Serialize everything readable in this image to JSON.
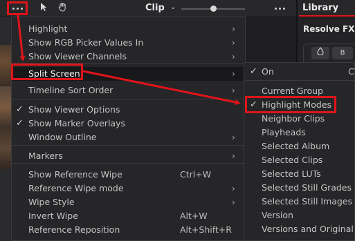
{
  "toolbar": {
    "more_icon": "ellipsis-icon",
    "pointer_icon": "pointer-icon",
    "hand_icon": "hand-icon",
    "mode_label": "Clip",
    "mode_chevron_icon": "chevron-down-icon",
    "zoom_level": 0.5,
    "right_more_icon": "ellipsis-icon"
  },
  "library": {
    "tab_label": "Library",
    "section_title": "Resolve FX B",
    "button_a_label": "🔥",
    "button_b_label": "B"
  },
  "menu": {
    "items": [
      {
        "label": "Highlight",
        "checked": false,
        "shortcut": "",
        "submenu": true
      },
      {
        "label": "Show RGB Picker Values In",
        "checked": false,
        "shortcut": "",
        "submenu": true
      },
      {
        "label": "Show Viewer Channels",
        "checked": false,
        "shortcut": "",
        "submenu": true
      },
      {
        "label": "Split Screen",
        "checked": false,
        "shortcut": "",
        "submenu": true
      },
      {
        "label": "Timeline Sort Order",
        "checked": false,
        "shortcut": "",
        "submenu": true
      },
      {
        "label": "Show Viewer Options",
        "checked": true,
        "shortcut": "",
        "submenu": false
      },
      {
        "label": "Show Marker Overlays",
        "checked": true,
        "shortcut": "",
        "submenu": false
      },
      {
        "label": "Window Outline",
        "checked": false,
        "shortcut": "",
        "submenu": true
      },
      {
        "label": "Markers",
        "checked": false,
        "shortcut": "",
        "submenu": true
      },
      {
        "label": "Show Reference Wipe",
        "checked": false,
        "shortcut": "Ctrl+W",
        "submenu": false
      },
      {
        "label": "Reference Wipe mode",
        "checked": false,
        "shortcut": "",
        "submenu": true
      },
      {
        "label": "Wipe Style",
        "checked": false,
        "shortcut": "",
        "submenu": true
      },
      {
        "label": "Invert Wipe",
        "checked": false,
        "shortcut": "Alt+W",
        "submenu": false
      },
      {
        "label": "Reference Reposition",
        "checked": false,
        "shortcut": "Alt+Shift+R",
        "submenu": false
      }
    ]
  },
  "submenu": {
    "items": [
      {
        "label": "On",
        "checked": true,
        "shortcut": "CT"
      },
      {
        "label": "Current Group",
        "checked": false,
        "shortcut": ""
      },
      {
        "label": "Highlight Modes",
        "checked": true,
        "shortcut": ""
      },
      {
        "label": "Neighbor Clips",
        "checked": false,
        "shortcut": ""
      },
      {
        "label": "Playheads",
        "checked": false,
        "shortcut": ""
      },
      {
        "label": "Selected Album",
        "checked": false,
        "shortcut": ""
      },
      {
        "label": "Selected Clips",
        "checked": false,
        "shortcut": ""
      },
      {
        "label": "Selected LUTs",
        "checked": false,
        "shortcut": ""
      },
      {
        "label": "Selected Still Grades",
        "checked": false,
        "shortcut": ""
      },
      {
        "label": "Selected Still Images",
        "checked": false,
        "shortcut": ""
      },
      {
        "label": "Version",
        "checked": false,
        "shortcut": ""
      },
      {
        "label": "Versions and Original",
        "checked": false,
        "shortcut": ""
      }
    ]
  },
  "glyphs": {
    "check": "✓",
    "arrow": "›",
    "pointer": "➤",
    "hand": "✋",
    "chevron": "⌄"
  },
  "colors": {
    "annotation": "#e0141a",
    "menu_bg": "#262629",
    "active_bg": "#18181a"
  }
}
